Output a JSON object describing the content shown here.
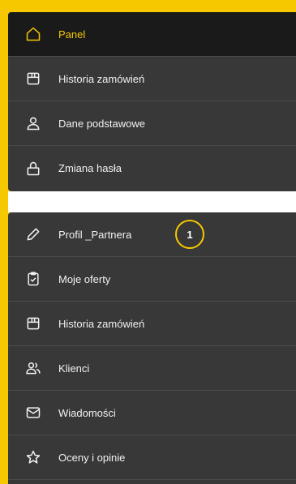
{
  "colors": {
    "accent": "#f6c800",
    "panel": "#383838",
    "active": "#1a1a1a",
    "text": "#f2f2f2"
  },
  "top_menu": {
    "items": [
      {
        "label": "Panel",
        "icon": "home-icon",
        "active": true
      },
      {
        "label": "Historia zamówień",
        "icon": "box-icon"
      },
      {
        "label": "Dane podstawowe",
        "icon": "user-icon"
      },
      {
        "label": "Zmiana hasła",
        "icon": "lock-icon"
      }
    ]
  },
  "bottom_menu": {
    "items": [
      {
        "label": "Profil _Partnera",
        "icon": "pencil-icon",
        "badge": "1"
      },
      {
        "label": "Moje oferty",
        "icon": "clipboard-check-icon"
      },
      {
        "label": "Historia zamówień",
        "icon": "box-icon"
      },
      {
        "label": "Klienci",
        "icon": "users-icon"
      },
      {
        "label": "Wiadomości",
        "icon": "mail-icon"
      },
      {
        "label": "Oceny i opinie",
        "icon": "star-icon"
      }
    ]
  }
}
